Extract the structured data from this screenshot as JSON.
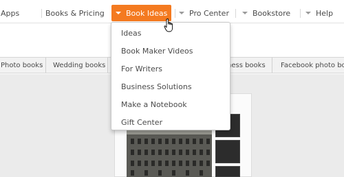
{
  "nav": {
    "items": [
      {
        "label": "Apps"
      },
      {
        "label": "Books & Pricing"
      },
      {
        "label": "Book Ideas"
      },
      {
        "label": "Pro Center"
      },
      {
        "label": "Bookstore"
      },
      {
        "label": "Help"
      }
    ],
    "active_color": "#f47a20"
  },
  "dropdown": {
    "items": [
      "Ideas",
      "Book Maker Videos",
      "For Writers",
      "Business Solutions",
      "Make a Notebook",
      "Gift Center"
    ]
  },
  "categories": [
    "Photo books",
    "Wedding books",
    "",
    "ness books",
    "Facebook photo boo"
  ]
}
